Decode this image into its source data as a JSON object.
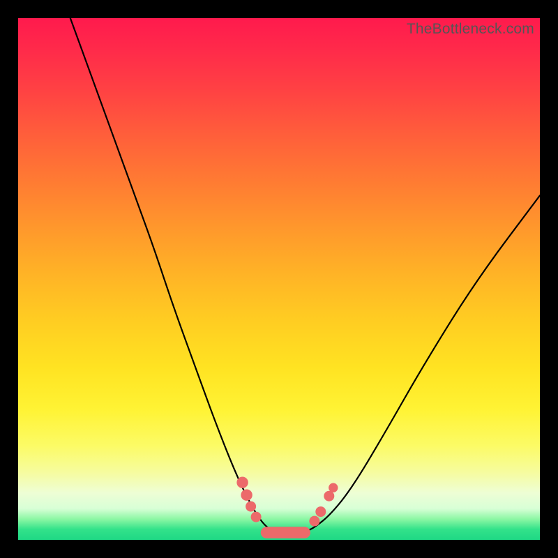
{
  "attribution": "TheBottleneck.com",
  "chart_data": {
    "type": "line",
    "title": "",
    "xlabel": "",
    "ylabel": "",
    "xlim": [
      0,
      100
    ],
    "ylim": [
      0,
      100
    ],
    "background": "red-yellow-green vertical gradient",
    "note": "X and Y are normalized to 0–100 of the plot area; Y=0 is bottom (green), Y=100 is top (red). Curve values are visual estimates.",
    "series": [
      {
        "name": "bottleneck-curve",
        "x": [
          10,
          14,
          18,
          22,
          26,
          30,
          34,
          38,
          42,
          45,
          47,
          49,
          51,
          53,
          55,
          57,
          60,
          64,
          70,
          78,
          88,
          100
        ],
        "y": [
          100,
          89,
          78,
          67,
          56,
          44,
          33,
          22,
          12,
          6,
          3,
          1.5,
          1.2,
          1.2,
          1.5,
          2.5,
          5,
          10,
          20,
          34,
          50,
          66
        ]
      }
    ],
    "markers": {
      "note": "Salmon marker cluster near the curve minimum (normalized coordinates).",
      "dots": [
        {
          "x": 43.0,
          "y": 11.0,
          "r": 1.1
        },
        {
          "x": 43.8,
          "y": 8.6,
          "r": 1.1
        },
        {
          "x": 44.6,
          "y": 6.4,
          "r": 1.0
        },
        {
          "x": 45.6,
          "y": 4.4,
          "r": 1.0
        },
        {
          "x": 56.8,
          "y": 3.6,
          "r": 1.0
        },
        {
          "x": 58.0,
          "y": 5.4,
          "r": 1.0
        },
        {
          "x": 59.6,
          "y": 8.4,
          "r": 1.0
        },
        {
          "x": 60.4,
          "y": 10.0,
          "r": 0.9
        }
      ],
      "bar": {
        "x0": 46.5,
        "x1": 56.0,
        "y": 1.4,
        "h": 2.2
      }
    }
  }
}
